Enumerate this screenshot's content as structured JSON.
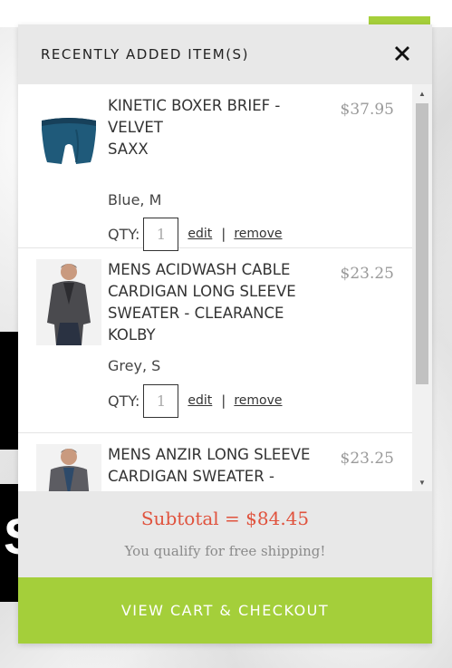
{
  "background": {
    "accent_color": "#a5cf3a"
  },
  "minicart": {
    "title": "RECENTLY ADDED ITEM(S)",
    "close_icon": "close-icon",
    "items": [
      {
        "name": "KINETIC BOXER BRIEF -\nVELVET\nSAXX",
        "price": "$37.95",
        "variant": "Blue, M",
        "qty_label": "QTY:",
        "qty_value": "1",
        "edit_label": "edit",
        "separator": "|",
        "remove_label": "remove"
      },
      {
        "name": "MENS ACIDWASH CABLE\nCARDIGAN LONG SLEEVE\nSWEATER - CLEARANCE\nKOLBY",
        "price": "$23.25",
        "variant": "Grey, S",
        "qty_label": "QTY:",
        "qty_value": "1",
        "edit_label": "edit",
        "separator": "|",
        "remove_label": "remove"
      },
      {
        "name": "MENS ANZIR LONG SLEEVE\nCARDIGAN SWEATER -",
        "price": "$23.25"
      }
    ],
    "subtotal": "Subtotal = $84.45",
    "shipping_note": "You qualify for free shipping!",
    "checkout_label": "VIEW CART & CHECKOUT",
    "colors": {
      "subtotal": "#e0533e",
      "checkout_button": "#a4cf3a"
    }
  }
}
